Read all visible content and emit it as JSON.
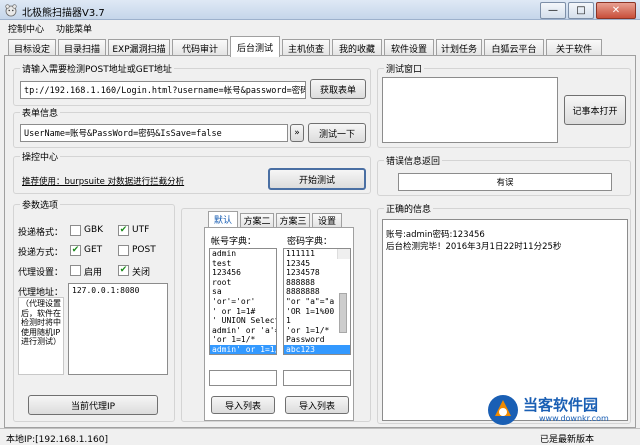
{
  "window": {
    "title": "北极熊扫描器V3.7",
    "minimize": "—",
    "maximize": "□",
    "close": "✕"
  },
  "menu": [
    "控制中心",
    "功能菜单"
  ],
  "tabs": [
    "目标设定",
    "目录扫描",
    "EXP漏洞扫描",
    "代码审计",
    "后台测试",
    "主机侦查",
    "我的收藏",
    "软件设置",
    "计划任务",
    "白狐云平台",
    "关于软件"
  ],
  "active_tab": 4,
  "url_group": {
    "label": "请输入需要检测POST地址或GET地址",
    "value": "tp://192.168.1.160/Login.html?username=帐号&password=密码&submit=",
    "button": "获取表单"
  },
  "form_group": {
    "label": "表单信息",
    "value": "UserName=账号&PassWord=密码&IsSave=false",
    "arrow_button": "»",
    "test_button": "测试一下"
  },
  "control_group": {
    "label": "操控中心",
    "hint": "推荐使用：burpsuite 对数据进行拦截分析",
    "start_button": "开始测试"
  },
  "params_group": {
    "label": "参数选项",
    "encoding_label": "投递格式：",
    "gbk_label": "GBK",
    "utf_label": "UTF",
    "method_label": "投递方式：",
    "get_label": "GET",
    "post_label": "POST",
    "proxy_label": "代理设置：",
    "enable_label": "启用",
    "disable_label": "关闭",
    "proxy_addr_label": "代理地址：",
    "proxy_addr_value": "127.0.0.1:8080",
    "proxy_note": "（代理设置后，软件在检测时将中使用随机IP进行测试）",
    "current_proxy_button": "当前代理IP",
    "check_mark": "✔",
    "checks": {
      "gbk": false,
      "utf": true,
      "get": true,
      "post": false,
      "enable": false,
      "disable": true
    }
  },
  "dict": {
    "tabs": [
      "默认",
      "方案二",
      "方案三",
      "设置"
    ],
    "username_label": "帐号字典：",
    "password_label": "密码字典：",
    "usernames": [
      "admin",
      "test",
      "123456",
      "root",
      "sa",
      "'or'='or'",
      "' or 1=1#",
      "' UNION Select",
      "admin' or 'a'='",
      "'or 1=1/*",
      "admin' or 1=1/*"
    ],
    "passwords": [
      "111111",
      "12345",
      "1234578",
      "888888",
      "8888888",
      "\"or \"a\"=\"a",
      "'OR 1=1%00",
      "1",
      "'or 1=1/*",
      "Password",
      "abc123"
    ],
    "import_button": "导入列表"
  },
  "test_window": {
    "label": "测试窗口",
    "notepad_button": "记事本打开"
  },
  "error_group": {
    "label": "错误信息返回",
    "value": "有误"
  },
  "correct_group": {
    "label": "正确的信息",
    "lines": [
      "账号:admin密码:123456",
      "后台检测完毕！2016年3月1日22时11分25秒"
    ]
  },
  "status": {
    "local_ip": "本地IP:[192.168.1.160]",
    "right": "已是最新版本"
  },
  "watermark": {
    "text": "当客软件园",
    "url": "www.downkr.com"
  },
  "colors": {
    "selection": "#3399ff",
    "watermark_blue": "#1a5fb4",
    "watermark_orange": "#f08a00"
  }
}
